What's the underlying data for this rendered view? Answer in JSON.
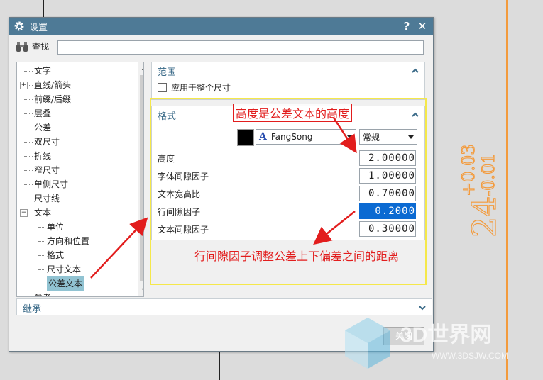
{
  "dialog": {
    "title": "设置",
    "help_label": "?",
    "close_label": "✕"
  },
  "search": {
    "label": "查找",
    "value": ""
  },
  "tree": {
    "items": [
      {
        "label": "文字",
        "level": 0
      },
      {
        "label": "直线/箭头",
        "level": 0,
        "expander": "+"
      },
      {
        "label": "前缀/后缀",
        "level": 0
      },
      {
        "label": "层叠",
        "level": 0
      },
      {
        "label": "公差",
        "level": 0
      },
      {
        "label": "双尺寸",
        "level": 0
      },
      {
        "label": "折线",
        "level": 0
      },
      {
        "label": "窄尺寸",
        "level": 0
      },
      {
        "label": "单侧尺寸",
        "level": 0
      },
      {
        "label": "尺寸线",
        "level": 0
      },
      {
        "label": "文本",
        "level": 0,
        "expander": "−"
      },
      {
        "label": "单位",
        "level": 1
      },
      {
        "label": "方向和位置",
        "level": 1
      },
      {
        "label": "格式",
        "level": 1
      },
      {
        "label": "尺寸文本",
        "level": 1
      },
      {
        "label": "公差文本",
        "level": 1,
        "selected": true
      },
      {
        "label": "参考",
        "level": 0
      }
    ]
  },
  "range_panel": {
    "title": "范围",
    "apply_all_label": "应用于整个尺寸",
    "apply_all_checked": false
  },
  "format_panel": {
    "title": "格式",
    "color": "#000000",
    "font_icon": "A",
    "font": "FangSong",
    "style": "常规",
    "fields": [
      {
        "label": "高度",
        "value": "2.00000"
      },
      {
        "label": "字体间隙因子",
        "value": "1.00000"
      },
      {
        "label": "文本宽高比",
        "value": "0.70000"
      },
      {
        "label": "行间隙因子",
        "value": "0.2000",
        "selected": true
      },
      {
        "label": "文本间隙因子",
        "value": "0.30000"
      }
    ]
  },
  "inherit_panel": {
    "title": "继承"
  },
  "buttons": {
    "close": "关闭"
  },
  "annotations": {
    "height_note": "高度是公差文本的高度",
    "line_gap_note": "行间隙因子调整公差上下偏差之间的距离"
  },
  "drawing": {
    "dimension_base": "24",
    "upper_tol": "+0.03",
    "lower_tol": "-0.01",
    "accent_color": "#f39b3d"
  },
  "watermark": {
    "brand": "3D世界网",
    "url": "WWW.3DSJW.COM"
  },
  "colors": {
    "titlebar": "#4e7a96",
    "panel_title": "#3a6a88",
    "selection": "#91c3d2",
    "annotation": "#e21d1d",
    "highlight_box": "#f5e84a"
  }
}
